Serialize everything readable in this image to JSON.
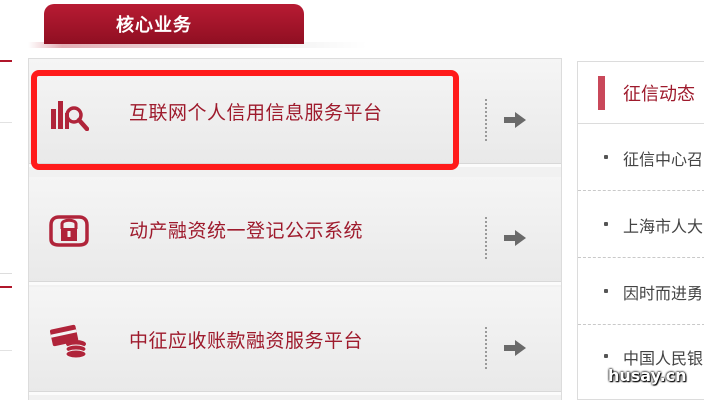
{
  "tab": {
    "label": "核心业务"
  },
  "services": [
    {
      "label": "互联网个人信用信息服务平台",
      "icon": "chart-search-icon",
      "arrow": "arrow-right-icon"
    },
    {
      "label": "动产融资统一登记公示系统",
      "icon": "money-lock-icon",
      "arrow": "arrow-right-icon"
    },
    {
      "label": "中征应收账款融资服务平台",
      "icon": "card-coins-icon",
      "arrow": "arrow-right-icon"
    }
  ],
  "news": {
    "title": "征信动态",
    "items": [
      {
        "text": "征信中心召"
      },
      {
        "text": "上海市人大"
      },
      {
        "text": "因时而进勇"
      },
      {
        "text": "中国人民银"
      }
    ]
  },
  "watermark": "husay.cn",
  "colors": {
    "brand_red": "#a3162a",
    "highlight": "#ff1b1b",
    "panel_bg": "#eeeeee"
  }
}
